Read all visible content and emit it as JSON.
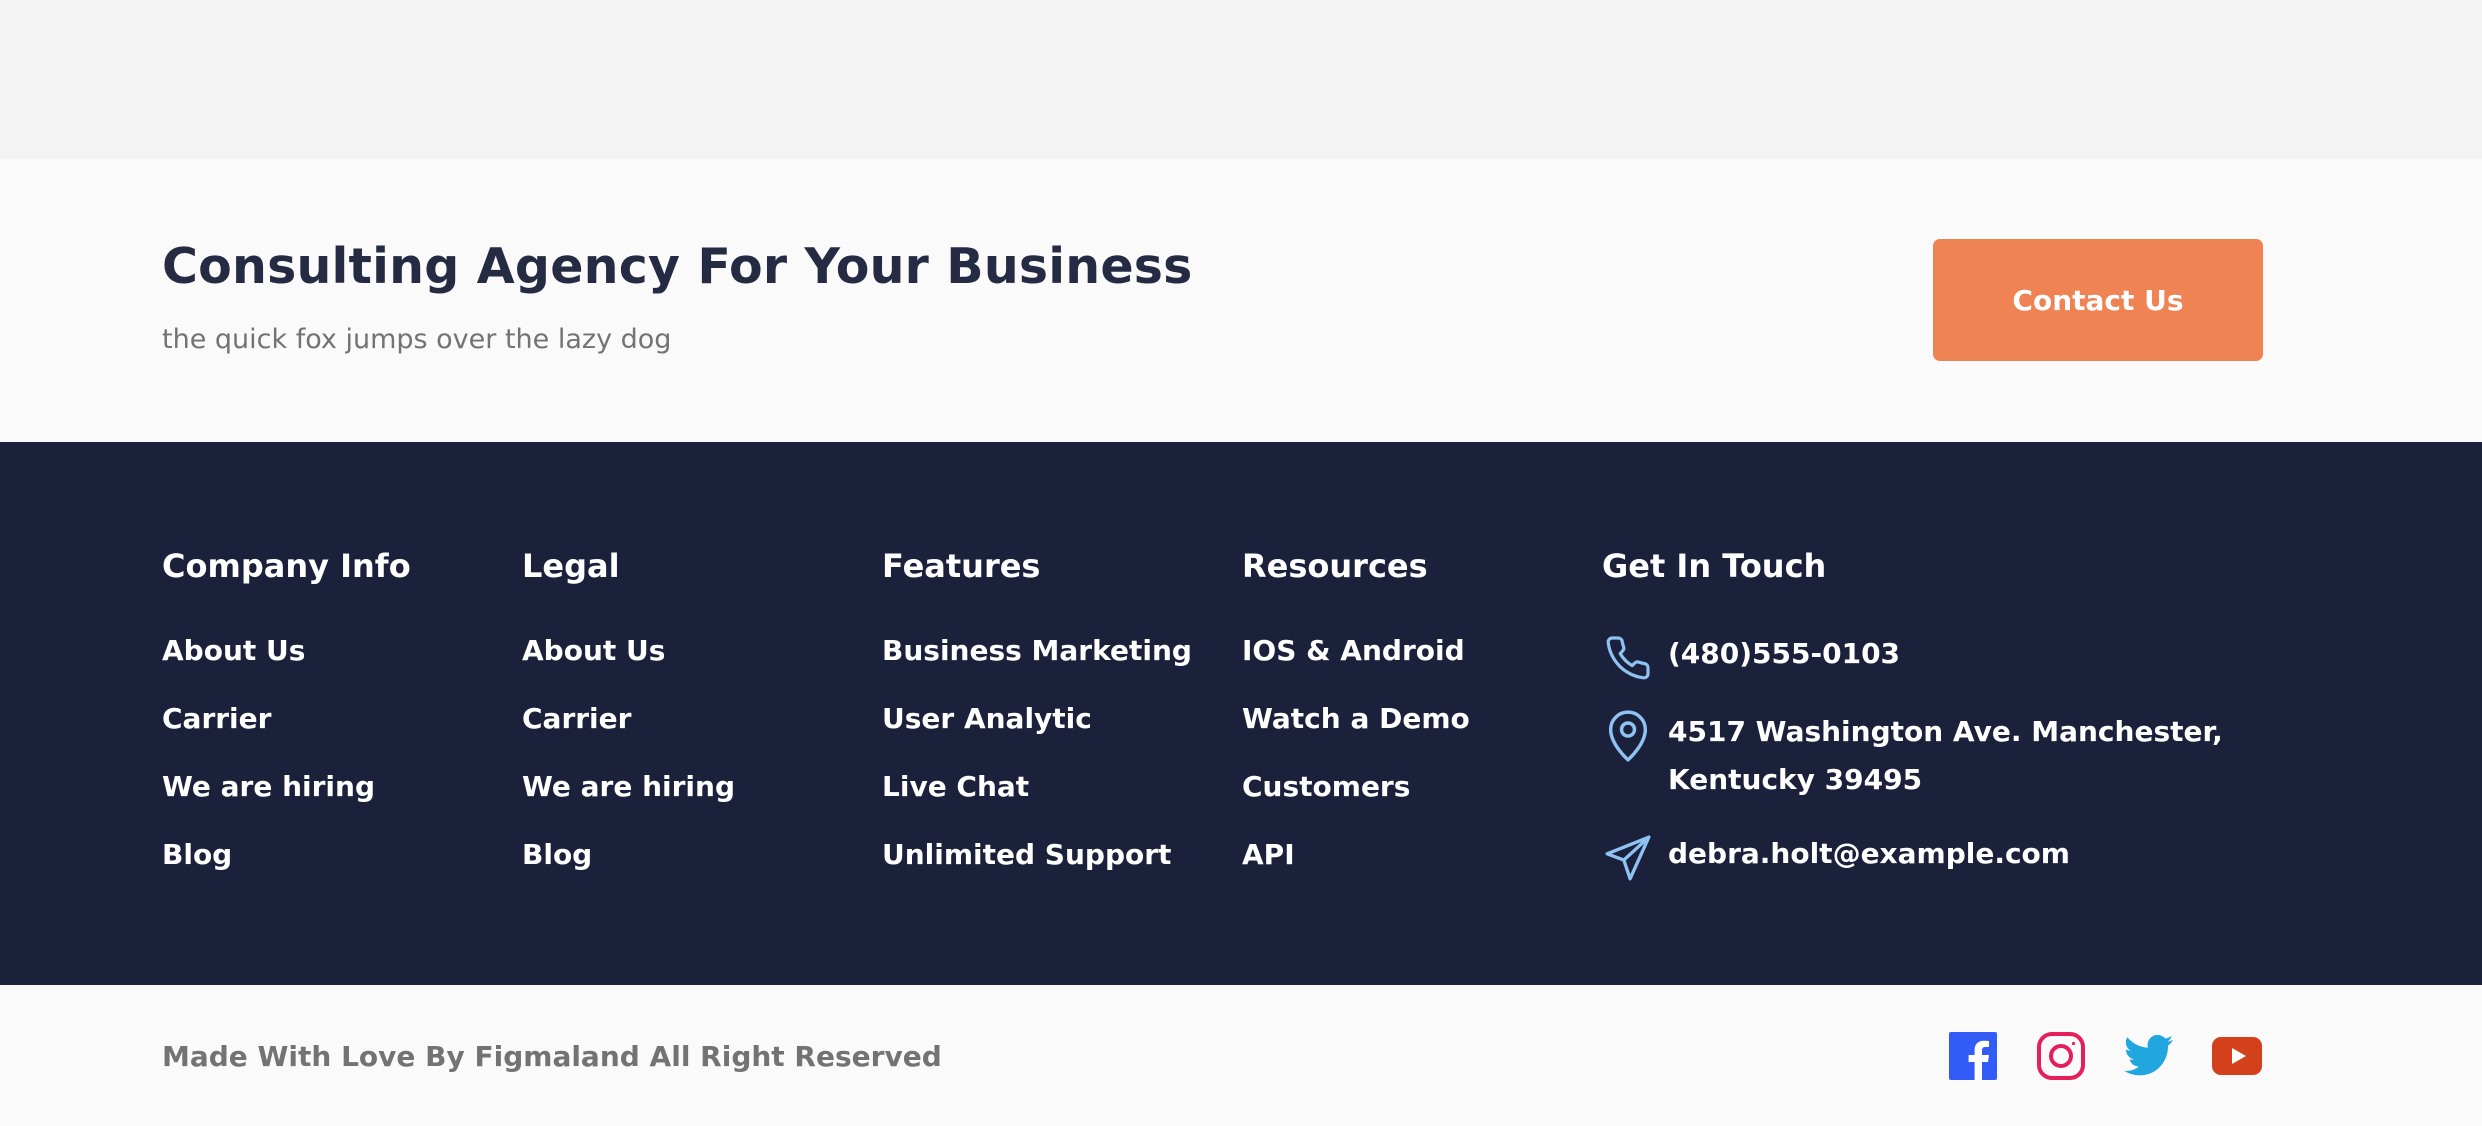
{
  "cta": {
    "title": "Consulting Agency For Your Business",
    "subtitle": "the quick fox jumps over the lazy dog",
    "button_label": "Contact Us"
  },
  "footer": {
    "columns": [
      {
        "title": "Company Info",
        "links": [
          "About Us",
          "Carrier",
          "We are hiring",
          "Blog"
        ]
      },
      {
        "title": "Legal",
        "links": [
          "About Us",
          "Carrier",
          "We are hiring",
          "Blog"
        ]
      },
      {
        "title": "Features",
        "links": [
          "Business Marketing",
          "User Analytic",
          "Live Chat",
          "Unlimited Support"
        ]
      },
      {
        "title": "Resources",
        "links": [
          "IOS & Android",
          "Watch a Demo",
          "Customers",
          "API"
        ]
      }
    ],
    "contact": {
      "title": "Get In Touch",
      "phone": "(480)555-0103",
      "address_line1": "4517 Washington Ave. Manchester,",
      "address_line2": "Kentucky 39495",
      "email": "debra.holt@example.com"
    }
  },
  "bottom": {
    "copyright": "Made With Love By Figmaland All Right Reserved",
    "social": [
      "facebook-icon",
      "instagram-icon",
      "twitter-icon",
      "youtube-icon"
    ]
  },
  "colors": {
    "accent": "#EF8354",
    "navy": "#1B213B",
    "heading": "#252B42",
    "muted": "#737373",
    "contact_icon": "#8EC2F2",
    "facebook": "#335BF5",
    "instagram": "#E51F5A",
    "twitter": "#21A6DF",
    "youtube": "#D3401C"
  }
}
